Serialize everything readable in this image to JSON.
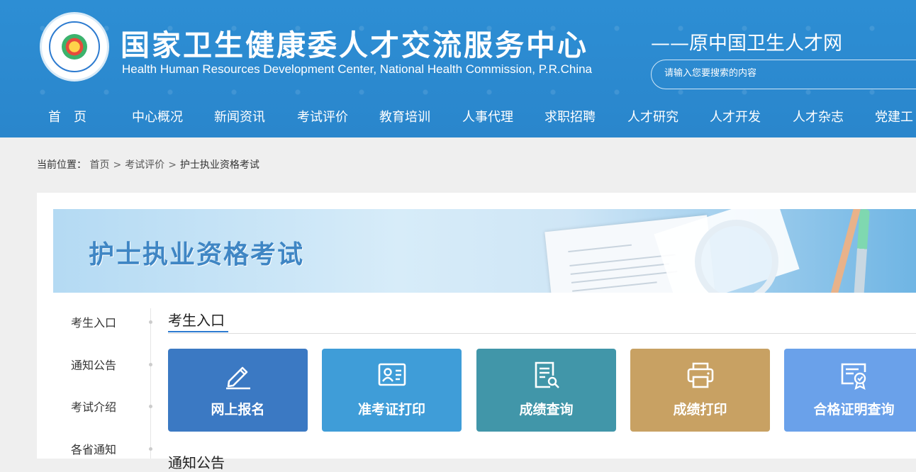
{
  "header": {
    "title": "国家卫生健康委人才交流服务中心",
    "subtitle": "Health Human Resources Development Center, National Health Commission, P.R.China",
    "slogan": "——原中国卫生人才网",
    "search_placeholder": "请输入您要搜索的内容",
    "logo_icon": "ncc-logo-icon"
  },
  "nav": [
    "首　页",
    "中心概况",
    "新闻资讯",
    "考试评价",
    "教育培训",
    "人事代理",
    "求职招聘",
    "人才研究",
    "人才开发",
    "人才杂志",
    "党建工"
  ],
  "breadcrumb": {
    "label": "当前位置：",
    "items": [
      "首页",
      "考试评价",
      "护士执业资格考试"
    ],
    "separator": ">"
  },
  "banner": {
    "title": "护士执业资格考试"
  },
  "sidebar": [
    "考生入口",
    "通知公告",
    "考试介绍",
    "各省通知"
  ],
  "section": {
    "title": "考生入口",
    "next_title": "通知公告"
  },
  "cards": [
    {
      "label": "网上报名",
      "icon": "pencil-icon",
      "color": "#3b79c3"
    },
    {
      "label": "准考证打印",
      "icon": "id-card-icon",
      "color": "#3f9dd8"
    },
    {
      "label": "成绩查询",
      "icon": "document-search-icon",
      "color": "#4196a9"
    },
    {
      "label": "成绩打印",
      "icon": "printer-icon",
      "color": "#c8a163"
    },
    {
      "label": "合格证明查询",
      "icon": "certificate-icon",
      "color": "#6aa1ea"
    }
  ],
  "colors": {
    "header_bg": "#2d8ed4",
    "accent": "#2d7bd0"
  }
}
